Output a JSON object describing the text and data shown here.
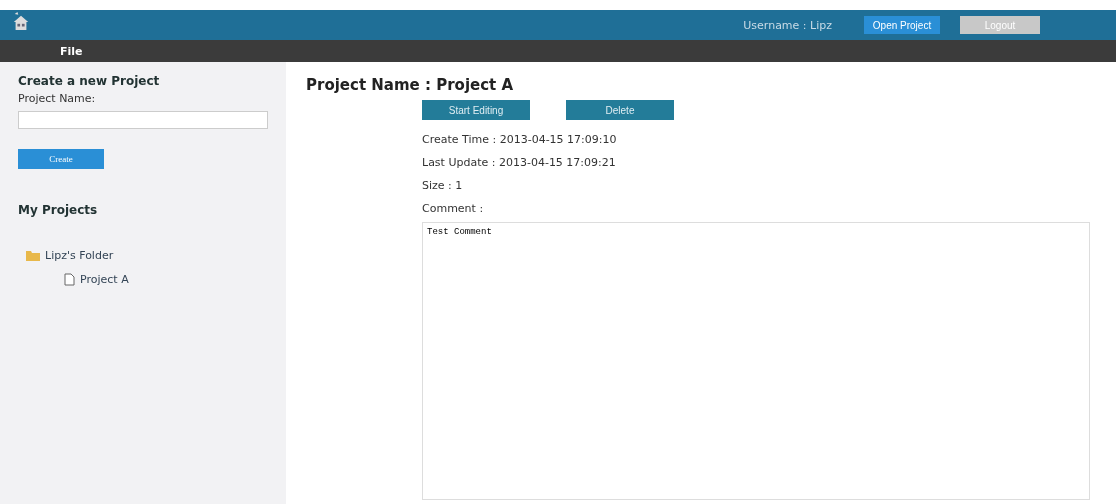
{
  "header": {
    "username": "Username : Lipz",
    "buttons": [
      {
        "label": "Open Project",
        "kind": "primary"
      },
      {
        "label": "Logout",
        "kind": "secondary"
      }
    ]
  },
  "menu": [
    "File"
  ],
  "create": {
    "title": "Create a new Project",
    "label": "Project Name:",
    "button": "Create"
  },
  "my_projects": {
    "title": "My Projects",
    "tree": [
      {
        "label": "Lipz's Folder",
        "kind": "folder",
        "children": [
          {
            "label": "Project A",
            "kind": "file"
          }
        ]
      }
    ]
  },
  "detail": {
    "title": "Project Name : Project A",
    "buttons": [
      "Start Editing",
      "Delete"
    ],
    "fields": [
      "Create Time : 2013-04-15 17:09:10",
      "Last Update : 2013-04-15 17:09:21",
      "Size : 1",
      "Comment :"
    ],
    "comment": "Test Comment"
  }
}
